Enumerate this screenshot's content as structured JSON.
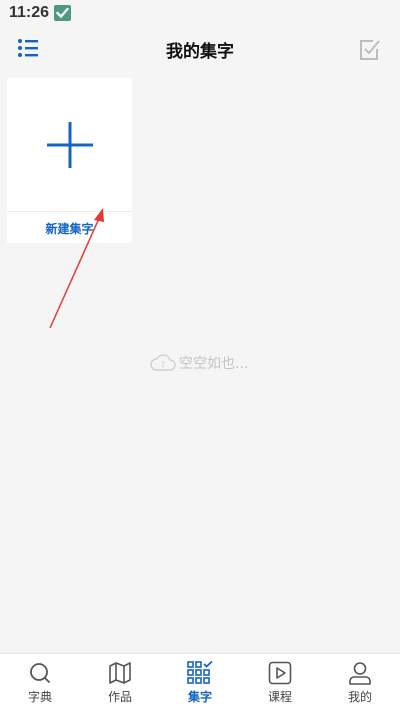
{
  "status_bar": {
    "time": "11:26"
  },
  "header": {
    "title": "我的集字"
  },
  "new_card": {
    "label": "新建集字"
  },
  "empty_state": {
    "text": "空空如也..."
  },
  "colors": {
    "accent": "#1565c0",
    "annotation_arrow": "#e53935",
    "background": "#f5f5f5"
  },
  "bottom_nav": {
    "items": [
      {
        "label": "字典",
        "icon": "search-icon"
      },
      {
        "label": "作品",
        "icon": "map-icon"
      },
      {
        "label": "集字",
        "icon": "grid-check-icon",
        "active": true
      },
      {
        "label": "课程",
        "icon": "play-icon"
      },
      {
        "label": "我的",
        "icon": "person-icon"
      }
    ]
  }
}
